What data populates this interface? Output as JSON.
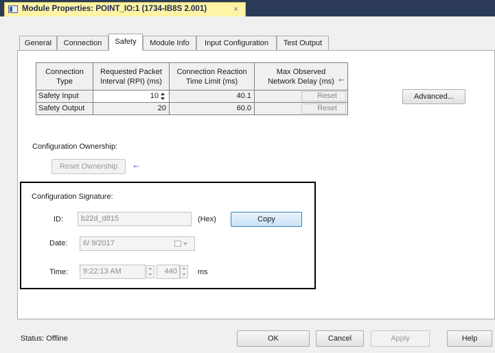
{
  "window": {
    "title": "Module Properties: POINT_IO:1 (1734-IB8S 2.001)",
    "close_glyph": "×"
  },
  "tabs": [
    {
      "label": "General"
    },
    {
      "label": "Connection"
    },
    {
      "label": "Safety"
    },
    {
      "label": "Module Info"
    },
    {
      "label": "Input Configuration"
    },
    {
      "label": "Test Output"
    }
  ],
  "active_tab": "Safety",
  "connection_table": {
    "headers": [
      "Connection Type",
      "Requested Packet Interval (RPI) (ms)",
      "Connection Reaction Time Limit (ms)",
      "Max Observed Network Delay (ms)"
    ],
    "rows": [
      {
        "type": "Safety Input",
        "rpi": "10",
        "reaction": "40.1",
        "reset": "Reset"
      },
      {
        "type": "Safety Output",
        "rpi": "20",
        "reaction": "60.0",
        "reset": "Reset"
      }
    ]
  },
  "advanced_button": "Advanced...",
  "ownership": {
    "label": "Configuration Ownership:",
    "reset_button": "Reset Ownership"
  },
  "signature": {
    "label": "Configuration Signature:",
    "id_label": "ID:",
    "id_value": "b22d_d815",
    "hex_label": "(Hex)",
    "copy_button": "Copy",
    "date_label": "Date:",
    "date_value": "6/ 9/2017",
    "time_label": "Time:",
    "time_value": "9:22:13 AM",
    "ms_value": "440",
    "ms_label": "ms"
  },
  "footer": {
    "status": "Status:  Offline",
    "ok": "OK",
    "cancel": "Cancel",
    "apply": "Apply",
    "help": "Help"
  },
  "arrow_glyph": "←",
  "colors": {
    "accent": "#1c3cb0",
    "callout_border": "#000000",
    "tab_highlight": "#fff3a6"
  }
}
